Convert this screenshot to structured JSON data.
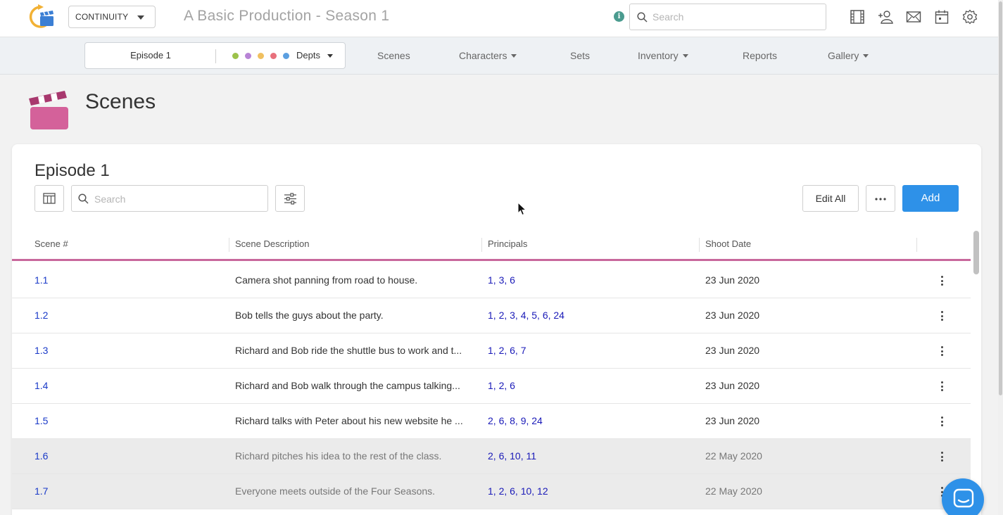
{
  "app": {
    "module": "CONTINUITY",
    "production_title": "A Basic Production - Season 1",
    "search_placeholder": "Search",
    "toolbar_icons": [
      "film-icon",
      "add-user-icon",
      "mail-icon",
      "calendar-icon",
      "settings-icon"
    ]
  },
  "nav": {
    "episode": "Episode 1",
    "dept_dots": [
      "#9cc24a",
      "#b884d6",
      "#f0c060",
      "#e8707c",
      "#5b9fe0"
    ],
    "depts_label": "Depts",
    "items": [
      {
        "label": "Scenes",
        "dropdown": false
      },
      {
        "label": "Characters",
        "dropdown": true
      },
      {
        "label": "Sets",
        "dropdown": false
      },
      {
        "label": "Inventory",
        "dropdown": true
      },
      {
        "label": "Reports",
        "dropdown": false
      },
      {
        "label": "Gallery",
        "dropdown": true
      }
    ]
  },
  "page": {
    "title": "Scenes",
    "accent_color": "#c8689c"
  },
  "card": {
    "title": "Episode 1",
    "search_placeholder": "Search",
    "edit_all_label": "Edit All",
    "add_label": "Add"
  },
  "table": {
    "columns": [
      "Scene #",
      "Scene Description",
      "Principals",
      "Shoot Date"
    ],
    "rows": [
      {
        "scene": "1.1",
        "description": "Camera shot panning from road to house.",
        "principals": "1, 3, 6",
        "date": "23 Jun 2020",
        "dimmed": false
      },
      {
        "scene": "1.2",
        "description": "Bob tells the guys about the party.",
        "principals": "1, 2, 3, 4, 5, 6, 24",
        "date": "23 Jun 2020",
        "dimmed": false
      },
      {
        "scene": "1.3",
        "description": "Richard and Bob ride the shuttle bus to work and t...",
        "principals": "1, 2, 6, 7",
        "date": "23 Jun 2020",
        "dimmed": false
      },
      {
        "scene": "1.4",
        "description": "Richard and Bob walk through the campus talking...",
        "principals": "1, 2, 6",
        "date": "23 Jun 2020",
        "dimmed": false
      },
      {
        "scene": "1.5",
        "description": "Richard talks with Peter about his new website he ...",
        "principals": "2, 6, 8, 9, 24",
        "date": "23 Jun 2020",
        "dimmed": false
      },
      {
        "scene": "1.6",
        "description": "Richard pitches his idea to the rest of the class.",
        "principals": "2, 6, 10, 11",
        "date": "22 May 2020",
        "dimmed": true
      },
      {
        "scene": "1.7",
        "description": "Everyone meets outside of the Four Seasons.",
        "principals": "1, 2, 6, 10, 12",
        "date": "22 May 2020",
        "dimmed": true
      }
    ]
  }
}
